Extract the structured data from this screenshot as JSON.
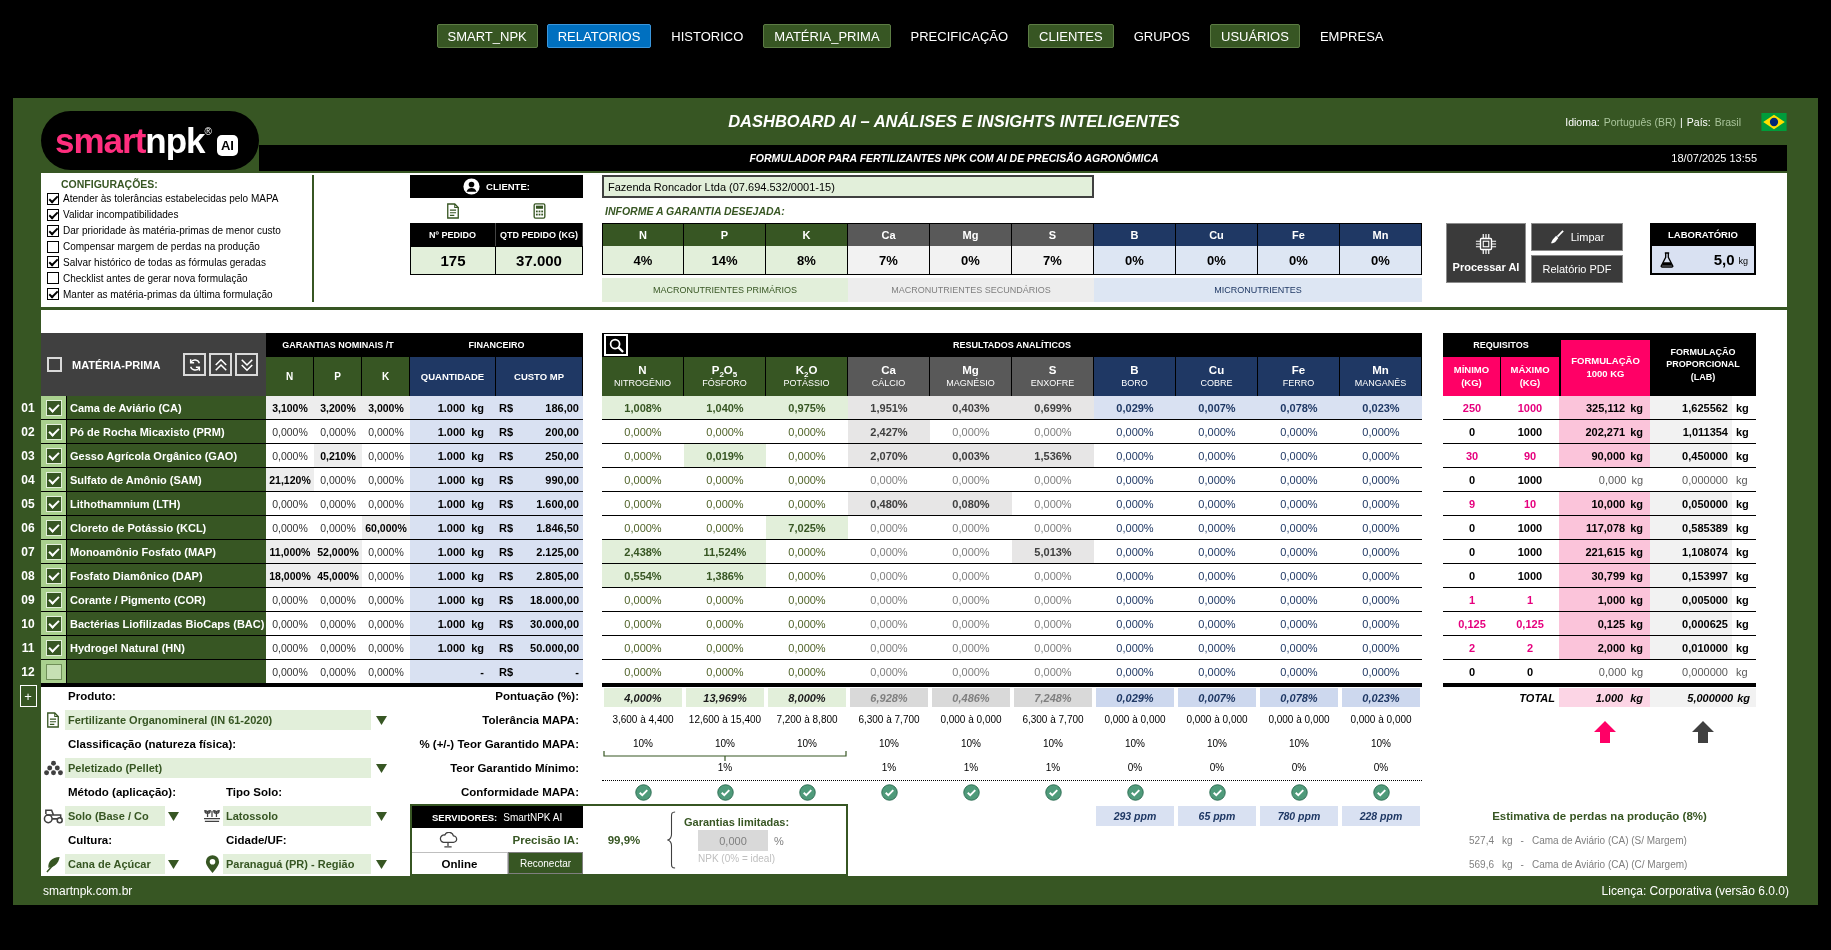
{
  "nav": [
    {
      "label": "SMART_NPK",
      "kind": "boxed",
      "selected": false
    },
    {
      "label": "RELATORIOS",
      "kind": "boxed",
      "selected": true
    },
    {
      "label": "HISTORICO",
      "kind": "plain",
      "selected": false
    },
    {
      "label": "MATÉRIA_PRIMA",
      "kind": "boxed",
      "selected": false
    },
    {
      "label": "PRECIFICAÇÃO",
      "kind": "plain",
      "selected": false
    },
    {
      "label": "CLIENTES",
      "kind": "boxed",
      "selected": false
    },
    {
      "label": "GRUPOS",
      "kind": "plain",
      "selected": false
    },
    {
      "label": "USUÁRIOS",
      "kind": "boxed",
      "selected": false
    },
    {
      "label": "EMPRESA",
      "kind": "plain",
      "selected": false
    }
  ],
  "logo": {
    "brand_first": "smart",
    "brand_second": "npk",
    "registered": "®",
    "badge": "AI"
  },
  "header": {
    "title": "DASHBOARD AI – ANÁLISES E INSIGHTS INTELIGENTES",
    "language_label": "Idioma:",
    "language": "Português (BR)",
    "separator": "|",
    "country_label": "País:",
    "country": "Brasil",
    "subtitle": "FORMULADOR PARA FERTILIZANTES NPK COM AI DE PRECISÃO AGRONÔMICA",
    "datetime": "18/07/2025 13:55"
  },
  "config": {
    "title": "CONFIGURAÇÕES:",
    "items": [
      {
        "label": "Atender às tolerâncias estabelecidas pelo MAPA",
        "checked": true
      },
      {
        "label": "Validar incompatibilidades",
        "checked": true
      },
      {
        "label": "Dar prioridade às matéria-primas de menor custo",
        "checked": true
      },
      {
        "label": "Compensar margem de perdas na produção",
        "checked": false
      },
      {
        "label": "Salvar histórico de todas as fórmulas geradas",
        "checked": true
      },
      {
        "label": "Checklist antes de gerar nova formulação",
        "checked": false
      },
      {
        "label": "Manter as matéria-primas da última formulação",
        "checked": true
      }
    ]
  },
  "client": {
    "label": "CLIENTE:",
    "value": "Fazenda Roncador Ltda (07.694.532/0001-15)"
  },
  "order": {
    "number_label": "Nº PEDIDO",
    "number": "175",
    "quantity_label": "QTD PEDIDO (KG)",
    "quantity": "37.000"
  },
  "guarantee": {
    "title": "INFORME A GARANTIA DESEJADA:",
    "groups": [
      {
        "kind": "primary",
        "label": "MACRONUTRIENTES PRIMÁRIOS",
        "nutrients": [
          {
            "symbol": "N",
            "value": "4%"
          },
          {
            "symbol": "P",
            "value": "14%"
          },
          {
            "symbol": "K",
            "value": "8%"
          }
        ]
      },
      {
        "kind": "secondary",
        "label": "MACRONUTRIENTES SECUNDÁRIOS",
        "nutrients": [
          {
            "symbol": "Ca",
            "value": "7%"
          },
          {
            "symbol": "Mg",
            "value": "0%"
          },
          {
            "symbol": "S",
            "value": "7%"
          }
        ]
      },
      {
        "kind": "micro",
        "label": "MICRONUTRIENTES",
        "nutrients": [
          {
            "symbol": "B",
            "value": "0%"
          },
          {
            "symbol": "Cu",
            "value": "0%"
          },
          {
            "symbol": "Fe",
            "value": "0%"
          },
          {
            "symbol": "Mn",
            "value": "0%"
          }
        ]
      }
    ]
  },
  "actions": {
    "process": "Processar AI",
    "clear": "Limpar",
    "report": "Relatório PDF"
  },
  "lab": {
    "label": "LABORATÓRIO",
    "value": "5,0",
    "unit": "kg"
  },
  "materials": {
    "title": "MATÉRIA-PRIMA",
    "all_checked": false,
    "nominal_title": "GARANTIAS NOMINAIS /T",
    "nominal_columns": [
      "N",
      "P",
      "K"
    ],
    "finance_title": "FINANCEIRO",
    "finance_columns": [
      "QUANTIDADE",
      "CUSTO MP"
    ],
    "rows": [
      {
        "index": "01",
        "checked": true,
        "name": "Cama de Aviário (CA)",
        "nominal": [
          "3,100%",
          "3,200%",
          "3,000%"
        ],
        "nominal_highlighted": [
          true,
          true,
          true
        ],
        "quantity": "1.000",
        "unit": "kg",
        "currency": "R$",
        "cost": "186,00"
      },
      {
        "index": "02",
        "checked": true,
        "name": "Pó de Rocha Micaxisto (PRM)",
        "nominal": [
          "0,000%",
          "0,000%",
          "0,000%"
        ],
        "nominal_highlighted": [
          false,
          false,
          false
        ],
        "quantity": "1.000",
        "unit": "kg",
        "currency": "R$",
        "cost": "200,00"
      },
      {
        "index": "03",
        "checked": true,
        "name": "Gesso Agrícola Orgânico (GAO)",
        "nominal": [
          "0,000%",
          "0,210%",
          "0,000%"
        ],
        "nominal_highlighted": [
          false,
          true,
          false
        ],
        "quantity": "1.000",
        "unit": "kg",
        "currency": "R$",
        "cost": "250,00"
      },
      {
        "index": "04",
        "checked": true,
        "name": "Sulfato de Amônio (SAM)",
        "nominal": [
          "21,120%",
          "0,000%",
          "0,000%"
        ],
        "nominal_highlighted": [
          true,
          false,
          false
        ],
        "quantity": "1.000",
        "unit": "kg",
        "currency": "R$",
        "cost": "990,00"
      },
      {
        "index": "05",
        "checked": true,
        "name": "Lithothamnium (LTH)",
        "nominal": [
          "0,000%",
          "0,000%",
          "0,000%"
        ],
        "nominal_highlighted": [
          false,
          false,
          false
        ],
        "quantity": "1.000",
        "unit": "kg",
        "currency": "R$",
        "cost": "1.600,00"
      },
      {
        "index": "06",
        "checked": true,
        "name": "Cloreto de Potássio (KCL)",
        "nominal": [
          "0,000%",
          "0,000%",
          "60,000%"
        ],
        "nominal_highlighted": [
          false,
          false,
          true
        ],
        "quantity": "1.000",
        "unit": "kg",
        "currency": "R$",
        "cost": "1.846,50"
      },
      {
        "index": "07",
        "checked": true,
        "name": "Monoamônio Fosfato (MAP)",
        "nominal": [
          "11,000%",
          "52,000%",
          "0,000%"
        ],
        "nominal_highlighted": [
          true,
          true,
          false
        ],
        "quantity": "1.000",
        "unit": "kg",
        "currency": "R$",
        "cost": "2.125,00"
      },
      {
        "index": "08",
        "checked": true,
        "name": "Fosfato Diamônico (DAP)",
        "nominal": [
          "18,000%",
          "45,000%",
          "0,000%"
        ],
        "nominal_highlighted": [
          true,
          true,
          false
        ],
        "quantity": "1.000",
        "unit": "kg",
        "currency": "R$",
        "cost": "2.805,00"
      },
      {
        "index": "09",
        "checked": true,
        "name": "Corante / Pigmento (COR)",
        "nominal": [
          "0,000%",
          "0,000%",
          "0,000%"
        ],
        "nominal_highlighted": [
          false,
          false,
          false
        ],
        "quantity": "1.000",
        "unit": "kg",
        "currency": "R$",
        "cost": "18.000,00"
      },
      {
        "index": "10",
        "checked": true,
        "name": "Bactérias Liofilizadas BioCaps (BAC)",
        "nominal": [
          "0,000%",
          "0,000%",
          "0,000%"
        ],
        "nominal_highlighted": [
          false,
          false,
          false
        ],
        "quantity": "1.000",
        "unit": "kg",
        "currency": "R$",
        "cost": "30.000,00"
      },
      {
        "index": "11",
        "checked": true,
        "name": "Hydrogel Natural (HN)",
        "nominal": [
          "0,000%",
          "0,000%",
          "0,000%"
        ],
        "nominal_highlighted": [
          false,
          false,
          false
        ],
        "quantity": "1.000",
        "unit": "kg",
        "currency": "R$",
        "cost": "50.000,00"
      },
      {
        "index": "12",
        "checked": false,
        "nominal": [
          "0,000%",
          "0,000%",
          "0,000%"
        ],
        "nominal_highlighted": [
          false,
          false,
          false
        ],
        "quantity": "-",
        "currency": "R$",
        "cost": "-"
      }
    ]
  },
  "analysis": {
    "title": "RESULTADOS ANALÍTICOS",
    "columns": [
      {
        "kind": "primary",
        "symbol": "N",
        "name": "NITROGÊNIO"
      },
      {
        "kind": "primary",
        "symbol": "P$_{2}$O$_{5}$",
        "name": "FÓSFORO"
      },
      {
        "kind": "primary",
        "symbol": "K$_{2}$O",
        "name": "POTÁSSIO"
      },
      {
        "kind": "secondary",
        "symbol": "Ca",
        "name": "CÁLCIO"
      },
      {
        "kind": "secondary",
        "symbol": "Mg",
        "name": "MAGNÉSIO"
      },
      {
        "kind": "secondary",
        "symbol": "S",
        "name": "ENXOFRE"
      },
      {
        "kind": "micro",
        "symbol": "B",
        "name": "BORO"
      },
      {
        "kind": "micro",
        "symbol": "Cu",
        "name": "COBRE"
      },
      {
        "kind": "micro",
        "symbol": "Fe",
        "name": "FERRO"
      },
      {
        "kind": "micro",
        "symbol": "Mn",
        "name": "MANGANÊS"
      }
    ],
    "rows": [
      {
        "values": [
          "1,008%",
          "1,040%",
          "0,975%",
          "1,951%",
          "0,403%",
          "0,699%",
          "0,029%",
          "0,007%",
          "0,078%",
          "0,023%"
        ],
        "highlighted": [
          true,
          true,
          true,
          true,
          true,
          true,
          true,
          true,
          true,
          true
        ]
      },
      {
        "values": [
          "0,000%",
          "0,000%",
          "0,000%",
          "2,427%",
          "0,000%",
          "0,000%",
          "0,000%",
          "0,000%",
          "0,000%",
          "0,000%"
        ],
        "highlighted": [
          false,
          false,
          false,
          true,
          false,
          false,
          false,
          false,
          false,
          false
        ]
      },
      {
        "values": [
          "0,000%",
          "0,019%",
          "0,000%",
          "2,070%",
          "0,003%",
          "1,536%",
          "0,000%",
          "0,000%",
          "0,000%",
          "0,000%"
        ],
        "highlighted": [
          false,
          true,
          false,
          true,
          true,
          true,
          false,
          false,
          false,
          false
        ]
      },
      {
        "values": [
          "0,000%",
          "0,000%",
          "0,000%",
          "0,000%",
          "0,000%",
          "0,000%",
          "0,000%",
          "0,000%",
          "0,000%",
          "0,000%"
        ],
        "highlighted": [
          false,
          false,
          false,
          false,
          false,
          false,
          false,
          false,
          false,
          false
        ]
      },
      {
        "values": [
          "0,000%",
          "0,000%",
          "0,000%",
          "0,480%",
          "0,080%",
          "0,000%",
          "0,000%",
          "0,000%",
          "0,000%",
          "0,000%"
        ],
        "highlighted": [
          false,
          false,
          false,
          true,
          true,
          false,
          false,
          false,
          false,
          false
        ]
      },
      {
        "values": [
          "0,000%",
          "0,000%",
          "7,025%",
          "0,000%",
          "0,000%",
          "0,000%",
          "0,000%",
          "0,000%",
          "0,000%",
          "0,000%"
        ],
        "highlighted": [
          false,
          false,
          true,
          false,
          false,
          false,
          false,
          false,
          false,
          false
        ]
      },
      {
        "values": [
          "2,438%",
          "11,524%",
          "0,000%",
          "0,000%",
          "0,000%",
          "5,013%",
          "0,000%",
          "0,000%",
          "0,000%",
          "0,000%"
        ],
        "highlighted": [
          true,
          true,
          false,
          false,
          false,
          true,
          false,
          false,
          false,
          false
        ]
      },
      {
        "values": [
          "0,554%",
          "1,386%",
          "0,000%",
          "0,000%",
          "0,000%",
          "0,000%",
          "0,000%",
          "0,000%",
          "0,000%",
          "0,000%"
        ],
        "highlighted": [
          true,
          true,
          false,
          false,
          false,
          false,
          false,
          false,
          false,
          false
        ]
      },
      {
        "values": [
          "0,000%",
          "0,000%",
          "0,000%",
          "0,000%",
          "0,000%",
          "0,000%",
          "0,000%",
          "0,000%",
          "0,000%",
          "0,000%"
        ],
        "highlighted": [
          false,
          false,
          false,
          false,
          false,
          false,
          false,
          false,
          false,
          false
        ]
      },
      {
        "values": [
          "0,000%",
          "0,000%",
          "0,000%",
          "0,000%",
          "0,000%",
          "0,000%",
          "0,000%",
          "0,000%",
          "0,000%",
          "0,000%"
        ],
        "highlighted": [
          false,
          false,
          false,
          false,
          false,
          false,
          false,
          false,
          false,
          false
        ]
      },
      {
        "values": [
          "0,000%",
          "0,000%",
          "0,000%",
          "0,000%",
          "0,000%",
          "0,000%",
          "0,000%",
          "0,000%",
          "0,000%",
          "0,000%"
        ],
        "highlighted": [
          false,
          false,
          false,
          false,
          false,
          false,
          false,
          false,
          false,
          false
        ]
      },
      {
        "values": [
          "0,000%",
          "0,000%",
          "0,000%",
          "0,000%",
          "0,000%",
          "0,000%",
          "0,000%",
          "0,000%",
          "0,000%",
          "0,000%"
        ],
        "highlighted": [
          false,
          false,
          false,
          false,
          false,
          false,
          false,
          false,
          false,
          false
        ]
      }
    ],
    "score": {
      "label": "Pontuação (%):",
      "values": [
        "4,000%",
        "13,969%",
        "8,000%",
        "6,928%",
        "0,486%",
        "7,248%",
        "0,029%",
        "0,007%",
        "0,078%",
        "0,023%"
      ]
    },
    "tolerance": {
      "label": "Tolerância MAPA:",
      "values": [
        "3,600 à 4,400",
        "12,600 à 15,400",
        "7,200 à 8,800",
        "6,300 à 7,700",
        "0,000 à 0,000",
        "6,300 à 7,700",
        "0,000 à 0,000",
        "0,000 à 0,000",
        "0,000 à 0,000",
        "0,000 à 0,000"
      ]
    },
    "tolerance_pct": {
      "label": "% (+/-) Teor Garantido MAPA:",
      "values": [
        "10%",
        "10%",
        "10%",
        "10%",
        "10%",
        "10%",
        "10%",
        "10%",
        "10%",
        "10%"
      ]
    },
    "minimum": {
      "label": "Teor Garantido Mínimo:",
      "npk": "1%",
      "values": [
        "1%",
        "1%",
        "1%",
        "0%",
        "0%",
        "0%",
        "0%"
      ]
    },
    "conformity": {
      "label": "Conformidade MAPA:",
      "passed": [
        true,
        true,
        true,
        true,
        true,
        true,
        true,
        true,
        true,
        true
      ]
    },
    "ppm": [
      "293 ppm",
      "65 ppm",
      "780 ppm",
      "228 ppm"
    ]
  },
  "requirements": {
    "title": "REQUISITOS",
    "min_label": "MÍNIMO (KG)",
    "max_label": "MÁXIMO (KG)",
    "formulation_label": "FORMULAÇÃO 1000 KG",
    "proportional_label": "FORMULAÇÃO PROPORCIONAL (LAB)",
    "rows": [
      {
        "min": "250",
        "max": "1000",
        "constrained": true,
        "formulation": "325,112",
        "formulation_unit": "kg",
        "proportional": "1,625562",
        "proportional_unit": "kg",
        "active": true
      },
      {
        "min": "0",
        "max": "1000",
        "constrained": false,
        "formulation": "202,271",
        "formulation_unit": "kg",
        "proportional": "1,011354",
        "proportional_unit": "kg",
        "active": true
      },
      {
        "min": "30",
        "max": "90",
        "constrained": true,
        "formulation": "90,000",
        "formulation_unit": "kg",
        "proportional": "0,450000",
        "proportional_unit": "kg",
        "active": true
      },
      {
        "min": "0",
        "max": "1000",
        "constrained": false,
        "formulation": "0,000",
        "formulation_unit": "kg",
        "proportional": "0,000000",
        "proportional_unit": "kg",
        "active": false
      },
      {
        "min": "9",
        "max": "10",
        "constrained": true,
        "formulation": "10,000",
        "formulation_unit": "kg",
        "proportional": "0,050000",
        "proportional_unit": "kg",
        "active": true
      },
      {
        "min": "0",
        "max": "1000",
        "constrained": false,
        "formulation": "117,078",
        "formulation_unit": "kg",
        "proportional": "0,585389",
        "proportional_unit": "kg",
        "active": true
      },
      {
        "min": "0",
        "max": "1000",
        "constrained": false,
        "formulation": "221,615",
        "formulation_unit": "kg",
        "proportional": "1,108074",
        "proportional_unit": "kg",
        "active": true
      },
      {
        "min": "0",
        "max": "1000",
        "constrained": false,
        "formulation": "30,799",
        "formulation_unit": "kg",
        "proportional": "0,153997",
        "proportional_unit": "kg",
        "active": true
      },
      {
        "min": "1",
        "max": "1",
        "constrained": true,
        "formulation": "1,000",
        "formulation_unit": "kg",
        "proportional": "0,005000",
        "proportional_unit": "kg",
        "active": true
      },
      {
        "min": "0,125",
        "max": "0,125",
        "constrained": true,
        "formulation": "0,125",
        "formulation_unit": "kg",
        "proportional": "0,000625",
        "proportional_unit": "kg",
        "active": true
      },
      {
        "min": "2",
        "max": "2",
        "constrained": true,
        "formulation": "2,000",
        "formulation_unit": "kg",
        "proportional": "0,010000",
        "proportional_unit": "kg",
        "active": true
      },
      {
        "min": "0",
        "max": "0",
        "constrained": false,
        "formulation": "0,000",
        "formulation_unit": "kg",
        "proportional": "0,000000",
        "proportional_unit": "kg",
        "active": false
      }
    ],
    "total": {
      "label": "TOTAL",
      "formulation": "1.000",
      "formulation_unit": "kg",
      "proportional": "5,000000",
      "proportional_unit": "kg"
    }
  },
  "product": {
    "product": {
      "label": "Produto:",
      "value": "Fertilizante Organomineral (IN 61-2020)"
    },
    "classification": {
      "label": "Classificação (natureza física):",
      "value": "Peletizado (Pellet)"
    },
    "method": {
      "label": "Método (aplicação):",
      "value": "Solo (Base / Co"
    },
    "soil": {
      "label": "Tipo Solo:",
      "value": "Latossolo"
    },
    "crop": {
      "label": "Cultura:",
      "value": "Cana de Açúcar"
    },
    "city": {
      "label": "Cidade/UF:",
      "value": "Paranaguá (PR) - Região"
    }
  },
  "server": {
    "label": "SERVIDORES:",
    "name": "SmartNPK AI",
    "precision_label": "Precisão IA:",
    "precision": "99,9%",
    "status": "Online",
    "reconnect": "Reconectar",
    "limits_title": "Garantias limitadas:",
    "limit_value": "0,000",
    "limit_unit": "%",
    "limit_hint": "NPK (0% = ideal)"
  },
  "losses": {
    "title": "Estimativa de perdas na produção (8%)",
    "items": [
      {
        "amount": "527,4",
        "unit": "kg",
        "separator": "-",
        "text": "Cama de Aviário (CA) (S/ Margem)"
      },
      {
        "amount": "569,6",
        "unit": "kg",
        "separator": "-",
        "text": "Cama de Aviário (CA) (C/ Margem)"
      }
    ]
  },
  "add_button": "+",
  "footer": {
    "site": "smartnpk.com.br",
    "license": "Licença: Corporativa (versão 6.0.0)"
  }
}
